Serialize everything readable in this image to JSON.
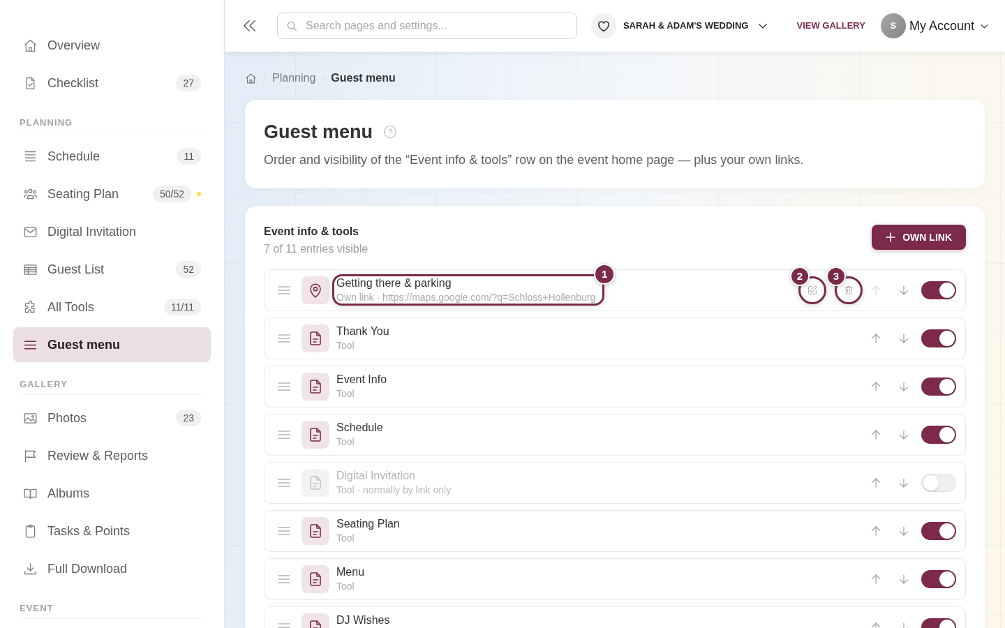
{
  "sidebar": {
    "sections": [
      {
        "items": [
          {
            "label": "Overview",
            "selected": false,
            "alert": false
          },
          {
            "label": "Checklist",
            "badge": "27",
            "selected": false,
            "alert": false
          }
        ]
      },
      {
        "title": "PLANNING",
        "items": [
          {
            "label": "Schedule",
            "badge": "11",
            "selected": false,
            "alert": false
          },
          {
            "label": "Seating Plan",
            "badge": "50/52",
            "selected": false,
            "alert": true
          },
          {
            "label": "Digital Invitation",
            "selected": false,
            "alert": false
          },
          {
            "label": "Guest List",
            "badge": "52",
            "selected": false,
            "alert": false
          },
          {
            "label": "All Tools",
            "badge": "11/11",
            "selected": false,
            "alert": false
          },
          {
            "label": "Guest menu",
            "selected": true,
            "alert": false
          }
        ]
      },
      {
        "title": "GALLERY",
        "items": [
          {
            "label": "Photos",
            "badge": "23",
            "selected": false,
            "alert": false
          },
          {
            "label": "Review & Reports",
            "selected": false,
            "alert": false
          },
          {
            "label": "Albums",
            "selected": false,
            "alert": false
          },
          {
            "label": "Tasks & Points",
            "selected": false,
            "alert": false
          },
          {
            "label": "Full Download",
            "selected": false,
            "alert": false
          }
        ]
      },
      {
        "title": "EVENT"
      }
    ]
  },
  "topbar": {
    "search": {
      "placeholder": "Search pages and settings..."
    },
    "event": "SARAH & ADAM'S WEDDING",
    "gallery_link": "VIEW GALLERY",
    "avatar_initial": "S",
    "account": "My Account"
  },
  "breadcrumb": [
    "Planning",
    "Guest menu"
  ],
  "header": {
    "title": "Guest menu",
    "description": "Order and visibility of the “Event info & tools” row on the event home page — plus your own links."
  },
  "section": {
    "title": "Event info & tools",
    "subtitle": "7 of 11 entries visible",
    "add_button": "OWN LINK",
    "entries": [
      {
        "kind": "link",
        "title": "Getting there & parking",
        "subtitle": "Own link · https://maps.google.com/?q=Schloss+Hollenburg",
        "on": true,
        "up_disabled": true,
        "callout": "1",
        "edit_callout": "2",
        "delete_callout": "3"
      },
      {
        "kind": "tool",
        "title": "Thank You",
        "subtitle": "Tool",
        "on": true,
        "up_disabled": false
      },
      {
        "kind": "tool",
        "title": "Event Info",
        "subtitle": "Tool",
        "on": true,
        "up_disabled": false
      },
      {
        "kind": "tool",
        "title": "Schedule",
        "subtitle": "Tool",
        "on": true,
        "up_disabled": false
      },
      {
        "kind": "tool",
        "title": "Digital Invitation",
        "subtitle": "Tool · normally by link only",
        "on": false,
        "up_disabled": false
      },
      {
        "kind": "tool",
        "title": "Seating Plan",
        "subtitle": "Tool",
        "on": true,
        "up_disabled": false
      },
      {
        "kind": "tool",
        "title": "Menu",
        "subtitle": "Tool",
        "on": true,
        "up_disabled": false
      },
      {
        "kind": "tool",
        "title": "DJ Wishes",
        "on": true,
        "up_disabled": false
      }
    ]
  }
}
